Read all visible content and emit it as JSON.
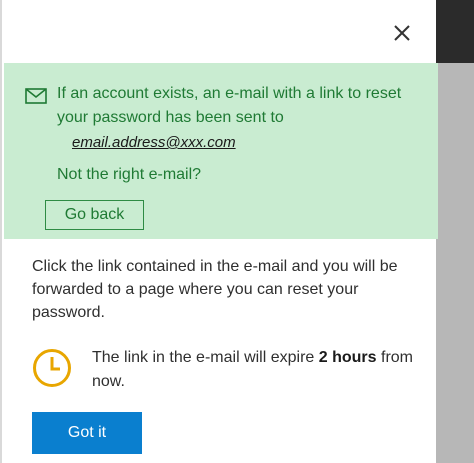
{
  "dialog": {
    "close_icon": "close-icon"
  },
  "notice": {
    "icon": "envelope-icon",
    "message": "If an account exists, an e-mail with a link to reset your password has been sent to",
    "email": "email.address@xxx.com",
    "wrong_email_prompt": "Not the right e-mail?",
    "go_back_label": "Go back",
    "background_color": "#c9ecd1",
    "text_color": "#1f7a34"
  },
  "instructions": {
    "text": "Click the link contained in the e-mail and you will be forwarded to a page where you can reset your password."
  },
  "expiry": {
    "icon": "clock-icon",
    "text_before": "The link in the e-mail will expire ",
    "duration": "2 hours",
    "text_after": " from now.",
    "icon_color": "#e8a600"
  },
  "actions": {
    "got_it_label": "Got it",
    "button_color": "#0a7fcf"
  }
}
